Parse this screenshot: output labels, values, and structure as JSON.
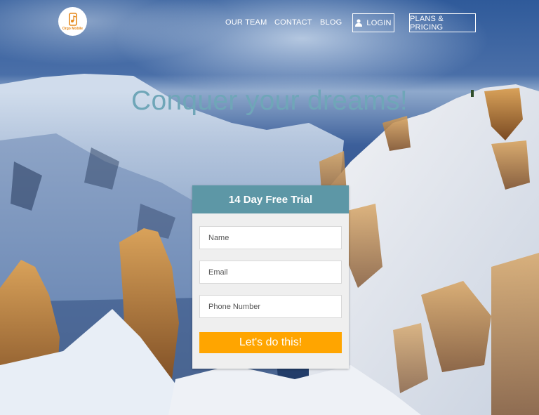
{
  "brand": {
    "logo_text": "Orgo Mobile"
  },
  "nav": {
    "our_team": "OUR TEAM",
    "contact": "CONTACT",
    "blog": "BLOG",
    "login": "LOGIN",
    "plans_pricing": "PLANS & PRICING"
  },
  "hero": {
    "headline": "Conquer your dreams!"
  },
  "trial_form": {
    "title": "14 Day Free Trial",
    "name_placeholder": "Name",
    "email_placeholder": "Email",
    "phone_placeholder": "Phone Number",
    "submit_label": "Let's do this!"
  },
  "colors": {
    "card_header": "#5d97a6",
    "submit_button": "#ffa500",
    "headline": "#6fa6b8",
    "logo_accent": "#e58a1f"
  },
  "icons": {
    "login": "user-icon",
    "logo": "phone-music-icon"
  }
}
